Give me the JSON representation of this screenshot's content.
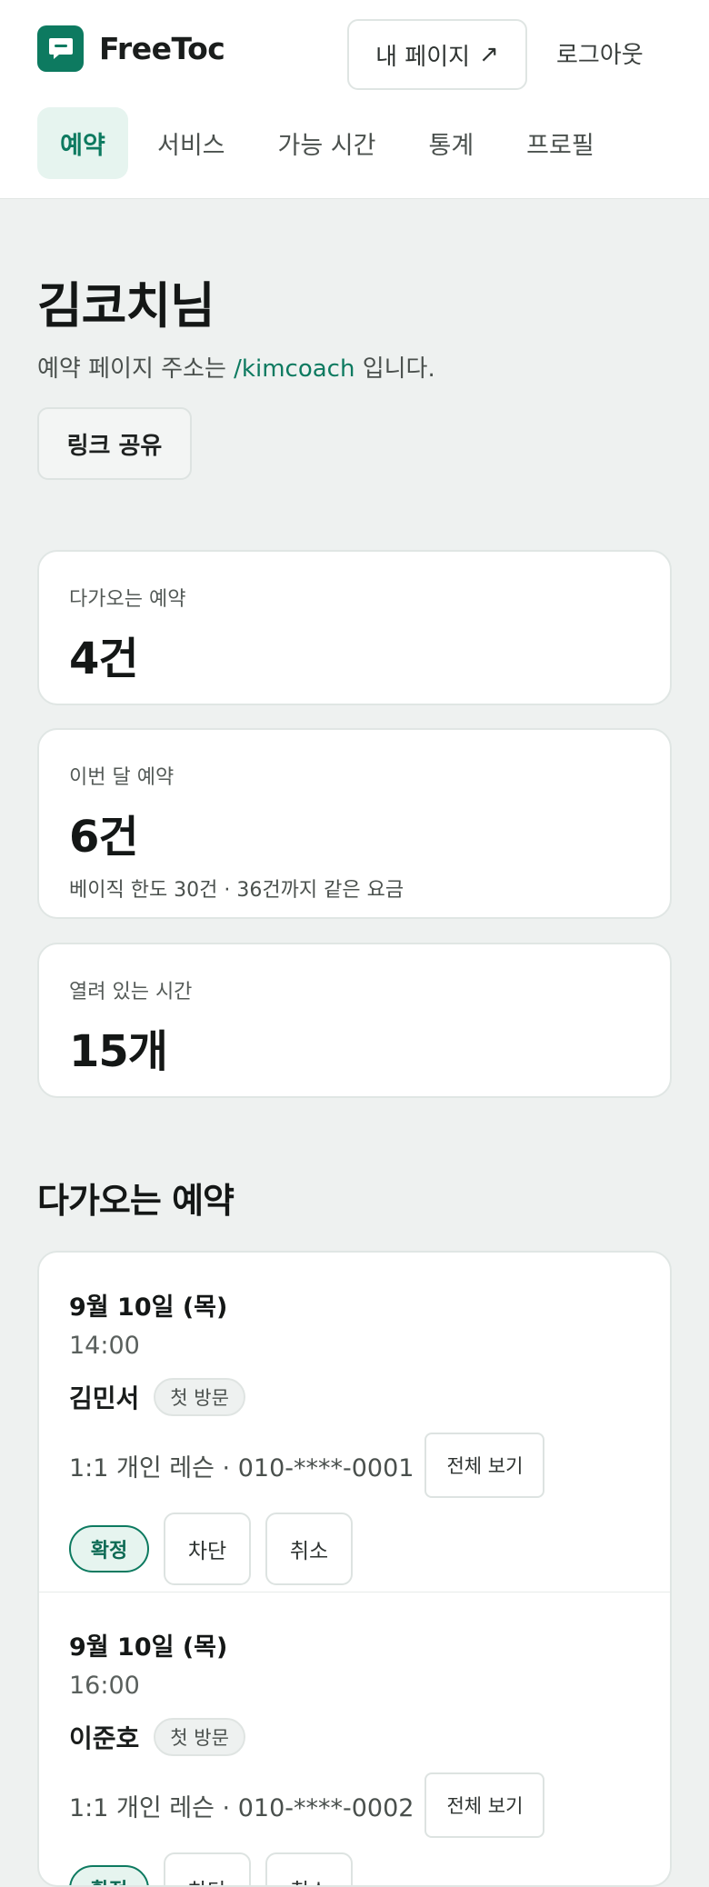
{
  "app": {
    "name": "FreeToc"
  },
  "header": {
    "mypage_label": "내 페이지",
    "mypage_arrow": "↗",
    "logout_label": "로그아웃"
  },
  "nav": {
    "tabs": [
      {
        "label": "예약",
        "active": true
      },
      {
        "label": "서비스",
        "active": false
      },
      {
        "label": "가능 시간",
        "active": false
      },
      {
        "label": "통계",
        "active": false
      },
      {
        "label": "프로필",
        "active": false
      }
    ]
  },
  "profile": {
    "name": "김코치님",
    "address_prefix": "예약 페이지 주소는 ",
    "address_slug": "/kimcoach",
    "address_suffix": " 입니다.",
    "share_label": "링크 공유"
  },
  "stats": {
    "upcoming": {
      "label": "다가오는 예약",
      "value": "4건"
    },
    "month": {
      "label": "이번 달 예약",
      "value": "6건",
      "note": "베이직 한도 30건 · 36건까지 같은 요금"
    },
    "open": {
      "label": "열려 있는 시간",
      "value": "15개"
    }
  },
  "upcoming": {
    "title": "다가오는 예약",
    "items": [
      {
        "date": "9월 10일 (목)",
        "time": "14:00",
        "name": "김민서",
        "badge": "첫 방문",
        "meta": "1:1 개인 레슨 · 010-****-0001",
        "view_label": "전체 보기",
        "status": "확정",
        "block_label": "차단",
        "cancel_label": "취소"
      },
      {
        "date": "9월 10일 (목)",
        "time": "16:00",
        "name": "이준호",
        "badge": "첫 방문",
        "meta": "1:1 개인 레슨 · 010-****-0002",
        "view_label": "전체 보기",
        "status": "확정",
        "block_label": "차단",
        "cancel_label": "취소"
      }
    ]
  },
  "colors": {
    "accent": "#0d7a60",
    "accent_soft": "#e6f4ef",
    "page_bg": "#eef1f0"
  }
}
